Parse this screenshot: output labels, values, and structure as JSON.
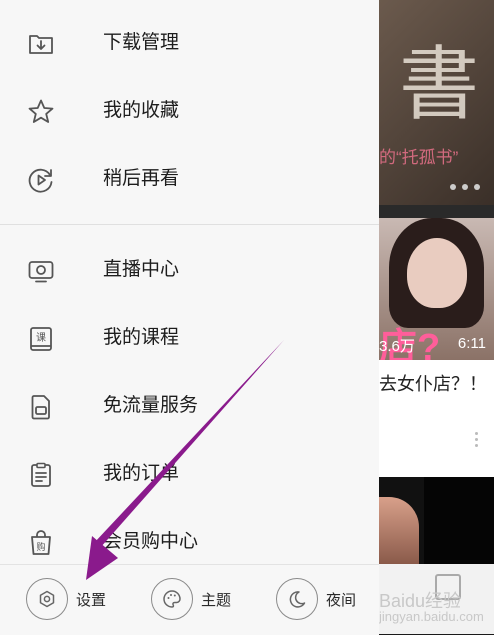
{
  "drawer": {
    "group1": [
      {
        "label": "下载管理",
        "icon": "download-folder-icon"
      },
      {
        "label": "我的收藏",
        "icon": "star-icon"
      },
      {
        "label": "稍后再看",
        "icon": "watch-later-icon"
      }
    ],
    "group2": [
      {
        "label": "直播中心",
        "icon": "live-tv-icon"
      },
      {
        "label": "我的课程",
        "icon": "course-book-icon"
      },
      {
        "label": "免流量服务",
        "icon": "sim-card-icon"
      },
      {
        "label": "我的订单",
        "icon": "order-clipboard-icon"
      },
      {
        "label": "会员购中心",
        "icon": "shopping-bag-icon"
      }
    ],
    "bottom": {
      "settings_label": "设置",
      "theme_label": "主题",
      "night_label": "夜间"
    }
  },
  "background_feed": {
    "banner_calligraphy": "書",
    "banner_caption": "的“托孤书”",
    "video_big_text": "店?",
    "video_views": "3.6万",
    "video_duration": "6:11",
    "video_title": "去女仆店？！",
    "watermark": "Baidu经验",
    "watermark_url": "jingyan.baidu.com"
  },
  "colors": {
    "annotation_arrow": "#8a1a8c",
    "drawer_bg": "#f7f7f7",
    "accent_pink": "#ff5e9a"
  }
}
